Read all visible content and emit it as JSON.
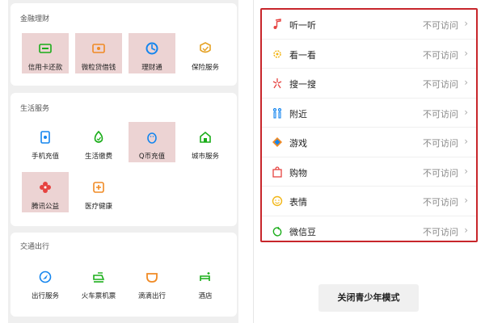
{
  "finance": {
    "title": "金融理财",
    "items": [
      {
        "label": "信用卡还款",
        "icon": "credit-card-icon",
        "highlight": true
      },
      {
        "label": "微粒贷借钱",
        "icon": "loan-icon",
        "highlight": true
      },
      {
        "label": "理财通",
        "icon": "wealth-icon",
        "highlight": true
      },
      {
        "label": "保险服务",
        "icon": "insurance-icon",
        "highlight": false
      }
    ]
  },
  "life": {
    "title": "生活服务",
    "items": [
      {
        "label": "手机充值",
        "icon": "phone-topup-icon",
        "highlight": false
      },
      {
        "label": "生活缴费",
        "icon": "utility-icon",
        "highlight": false
      },
      {
        "label": "Q币充值",
        "icon": "penguin-icon",
        "highlight": true
      },
      {
        "label": "城市服务",
        "icon": "city-icon",
        "highlight": false
      },
      {
        "label": "腾讯公益",
        "icon": "charity-icon",
        "highlight": true
      },
      {
        "label": "医疗健康",
        "icon": "health-icon",
        "highlight": false
      }
    ]
  },
  "traffic": {
    "title": "交通出行",
    "items": [
      {
        "label": "出行服务",
        "icon": "travel-icon",
        "highlight": false
      },
      {
        "label": "火车票机票",
        "icon": "train-icon",
        "highlight": false
      },
      {
        "label": "滴滴出行",
        "icon": "didi-icon",
        "highlight": false
      },
      {
        "label": "酒店",
        "icon": "hotel-icon",
        "highlight": false
      }
    ]
  },
  "menu": {
    "items": [
      {
        "label": "听一听",
        "status": "不可访问",
        "icon": "music-note-icon"
      },
      {
        "label": "看一看",
        "status": "不可访问",
        "icon": "look-icon"
      },
      {
        "label": "搜一搜",
        "status": "不可访问",
        "icon": "search-spark-icon"
      },
      {
        "label": "附近",
        "status": "不可访问",
        "icon": "nearby-people-icon"
      },
      {
        "label": "游戏",
        "status": "不可访问",
        "icon": "game-icon"
      },
      {
        "label": "购物",
        "status": "不可访问",
        "icon": "shopping-bag-icon"
      },
      {
        "label": "表情",
        "status": "不可访问",
        "icon": "emoji-icon"
      },
      {
        "label": "微信豆",
        "status": "不可访问",
        "icon": "wechat-bean-icon"
      }
    ],
    "chevron": "›"
  },
  "close_button": "关闭青少年模式",
  "colors": {
    "highlight_bg": "#ecd3d3",
    "box_border": "#c8262b",
    "green": "#1aad19",
    "blue": "#1485ee"
  }
}
